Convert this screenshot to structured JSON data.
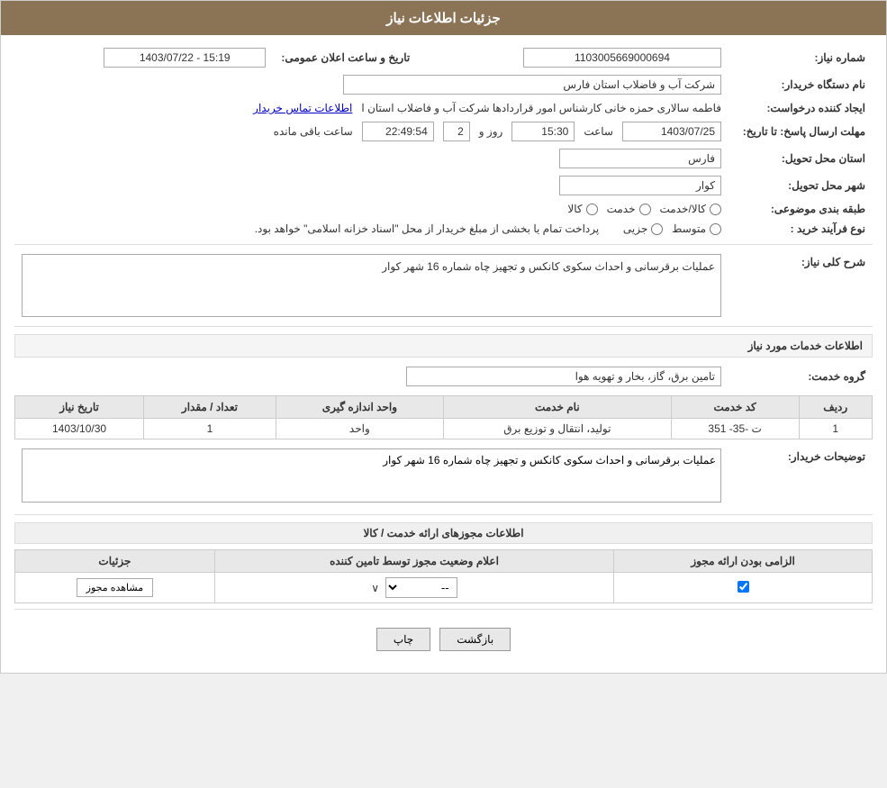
{
  "header": {
    "title": "جزئیات اطلاعات نیاز"
  },
  "fields": {
    "shomara_niaz_label": "شماره نیاز:",
    "shomara_niaz_value": "1103005669000694",
    "nam_dastgah_label": "نام دستگاه خریدار:",
    "nam_dastgah_value": "شرکت آب و فاضلاب استان فارس",
    "tarikh_label": "تاریخ و ساعت اعلان عمومی:",
    "tarikh_value": "1403/07/22 - 15:19",
    "ijad_label": "ایجاد کننده درخواست:",
    "ijad_value": "فاطمه سالاری حمزه خانی کارشناس امور قراردادها شرکت آب و فاضلاب استان ا",
    "ijad_link": "اطلاعات تماس خریدار",
    "mohlat_label": "مهلت ارسال پاسخ: تا تاریخ:",
    "mohlat_date": "1403/07/25",
    "mohlat_saat": "15:30",
    "mohlat_rooz": "2",
    "mohlat_countdown": "22:49:54",
    "ostan_label": "استان محل تحویل:",
    "ostan_value": "فارس",
    "shahr_label": "شهر محل تحویل:",
    "shahr_value": "کوار",
    "tabaqe_label": "طبقه بندی موضوعی:",
    "kala_label": "کالا",
    "khadamat_label": "خدمت",
    "kala_khadamat_label": "کالا/خدمت",
    "nooe_farayand_label": "نوع فرآیند خرید :",
    "jozee_label": "جزیی",
    "motavaset_label": "متوسط",
    "farayand_desc": "پرداخت تمام یا بخشی از مبلغ خریدار از محل \"اسناد خزانه اسلامی\" خواهد بود.",
    "sharh_label": "شرح کلی نیاز:",
    "sharh_value": "عملیات برقرسانی و احداث سکوی کانکس و تجهیز چاه شماره 16 شهر کوار",
    "khadamat_mored_label": "اطلاعات خدمات مورد نیاز",
    "gorohe_khadamat_label": "گروه خدمت:",
    "gorohe_khadamat_value": "تامین برق، گاز، بخار و تهویه هوا",
    "table": {
      "headers": [
        "ردیف",
        "کد خدمت",
        "نام خدمت",
        "واحد اندازه گیری",
        "تعداد / مقدار",
        "تاریخ نیاز"
      ],
      "rows": [
        {
          "radif": "1",
          "kod": "ت -35- 351",
          "nam": "تولید، انتقال و توزیع برق",
          "vahed": "واحد",
          "tedad": "1",
          "tarikh": "1403/10/30"
        }
      ]
    },
    "toseeh_label": "توضیحات خریدار:",
    "toseeh_value": "عملیات برقرسانی و احداث سکوی کانکس و تجهیز چاه شماره 16 شهر کوار",
    "mojooz_section": "اطلاعات مجوزهای ارائه خدمت / کالا",
    "mojooz_table": {
      "headers": [
        "الزامی بودن ارائه مجوز",
        "اعلام وضعیت مجوز توسط تامین کننده",
        "جزئیات"
      ],
      "rows": [
        {
          "elzami": true,
          "aalam": "--",
          "joziat": "مشاهده مجوز"
        }
      ]
    }
  },
  "buttons": {
    "print": "چاپ",
    "back": "بازگشت"
  }
}
